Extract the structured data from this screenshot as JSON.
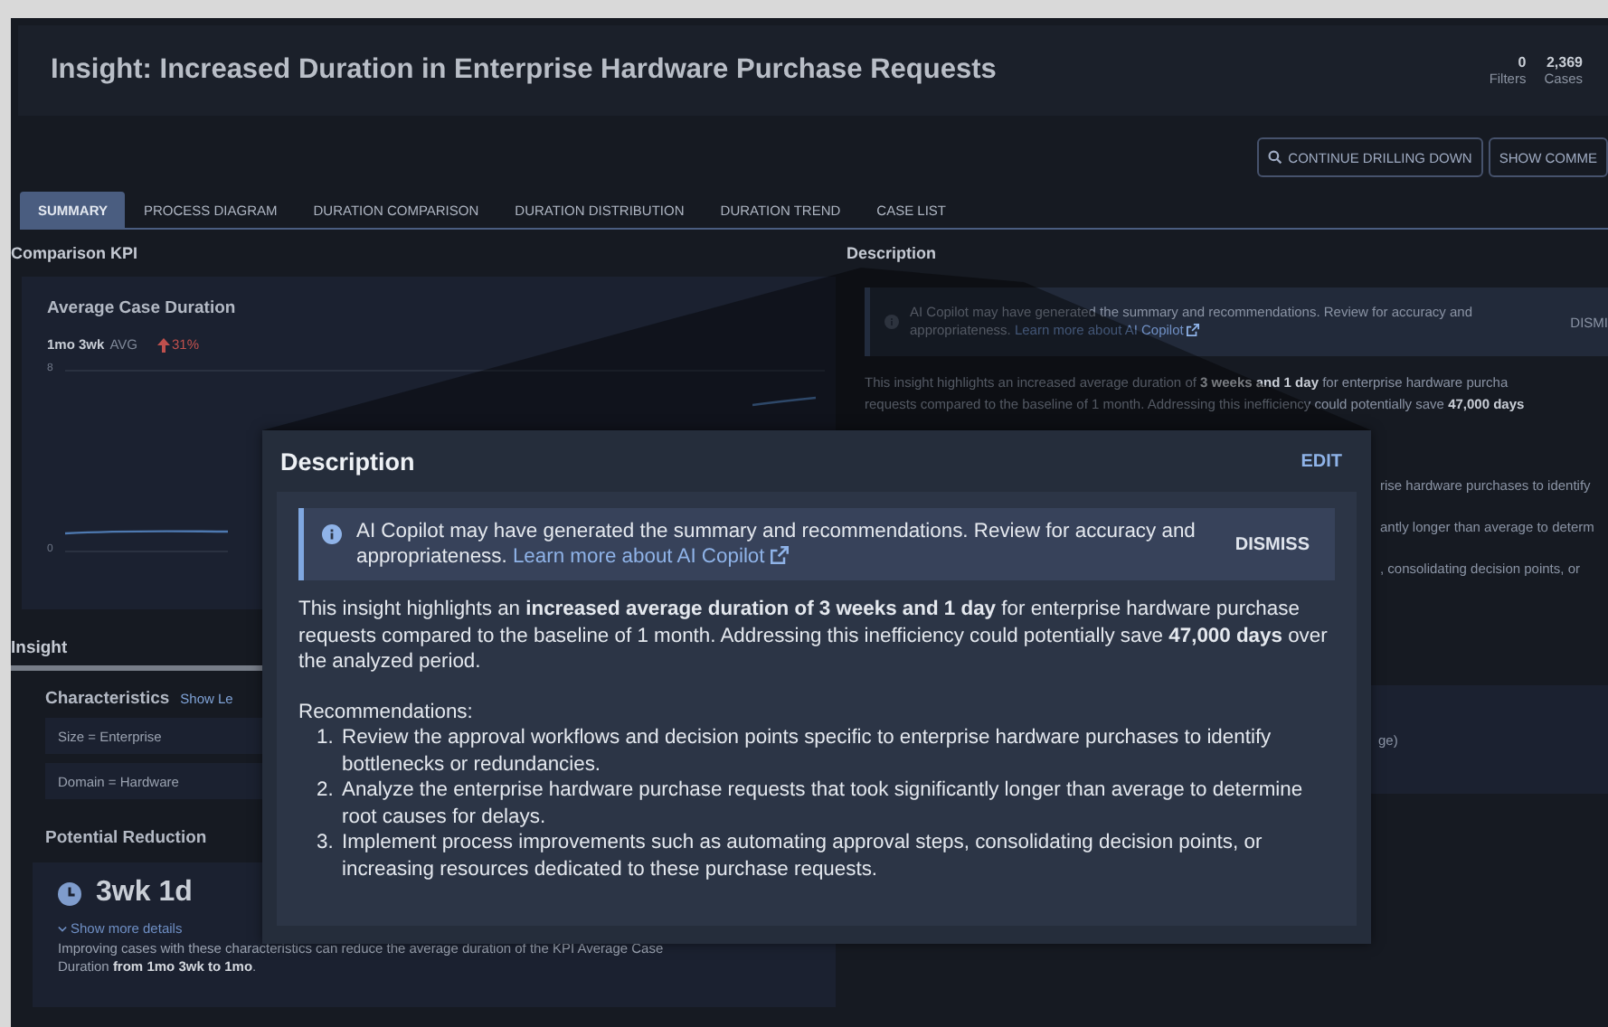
{
  "header": {
    "title": "Insight: Increased Duration in Enterprise Hardware Purchase Requests",
    "stats": [
      {
        "value": "0",
        "label": "Filters"
      },
      {
        "value": "2,369",
        "label": "Cases"
      }
    ]
  },
  "actions": [
    {
      "label": "CONTINUE DRILLING DOWN",
      "kind": "search"
    },
    {
      "label": "SHOW COMME",
      "kind": "plain"
    }
  ],
  "tabs": [
    {
      "label": "SUMMARY",
      "selected": true
    },
    {
      "label": "PROCESS DIAGRAM",
      "selected": false
    },
    {
      "label": "DURATION COMPARISON",
      "selected": false
    },
    {
      "label": "DURATION DISTRIBUTION",
      "selected": false
    },
    {
      "label": "DURATION TREND",
      "selected": false
    },
    {
      "label": "CASE LIST",
      "selected": false
    }
  ],
  "comparison_kpi": {
    "heading": "Comparison KPI",
    "card_title": "Average Case Duration",
    "value": "1mo 3wk",
    "value_suffix": "AVG",
    "change": "31%",
    "y_tick_labels": [
      "8",
      "0"
    ]
  },
  "insight": {
    "heading": "Insight",
    "characteristics_heading": "Characteristics",
    "show_toggle": "Show Le",
    "characteristics": [
      "Size = Enterprise",
      "Domain = Hardware"
    ],
    "reduction_heading": "Potential Reduction",
    "reduction_value": "3wk 1d",
    "details_link": "Show more details",
    "reduction_text": "Improving cases with these characteristics can reduce the average duration of the KPI Average Case Duration **from 1mo 3wk to 1mo**."
  },
  "description_panel": {
    "heading": "Description",
    "banner_text": "AI Copilot may have generated the summary and recommendations. Review for accuracy and appropriateness.",
    "banner_link": "Learn more about AI Copilot",
    "dismiss": "DISMI",
    "paragraph_lines": [
      "This insight highlights an increased average duration of **3 weeks and 1 day** for enterprise hardware purcha",
      "requests compared to the baseline of 1 month. Addressing this inefficiency could potentially save **47,000 days**"
    ],
    "fragments": [
      "rise hardware purchases to identify",
      "antly longer than average to determ",
      ", consolidating decision points, or"
    ],
    "panel_fragment": "ge)"
  },
  "overlay": {
    "heading": "Description",
    "action": "EDIT",
    "banner_text": "AI Copilot may have generated the summary and recommendations. Review for accuracy and appropriateness.",
    "banner_link": "Learn more about AI Copilot",
    "dismiss": "DISMISS",
    "summary": "This insight highlights an **increased average duration of 3 weeks and 1 day** for enterprise hardware purchase requests compared to the baseline of 1 month. Addressing this inefficiency could potentially save **47,000 days** over the analyzed period.",
    "recommendations_heading": "Recommendations:",
    "recommendations": [
      {
        "number": "1.",
        "text": "Review the approval workflows and decision points specific to enterprise hardware purchases to identify bottlenecks or redundancies."
      },
      {
        "number": "2.",
        "text": "Analyze the enterprise hardware purchase requests that took significantly longer than average to determine root causes for delays."
      },
      {
        "number": "3.",
        "text": "Implement process improvements such as automating approval steps, consolidating decision points, or increasing resources dedicated to these purchase requests."
      }
    ]
  }
}
